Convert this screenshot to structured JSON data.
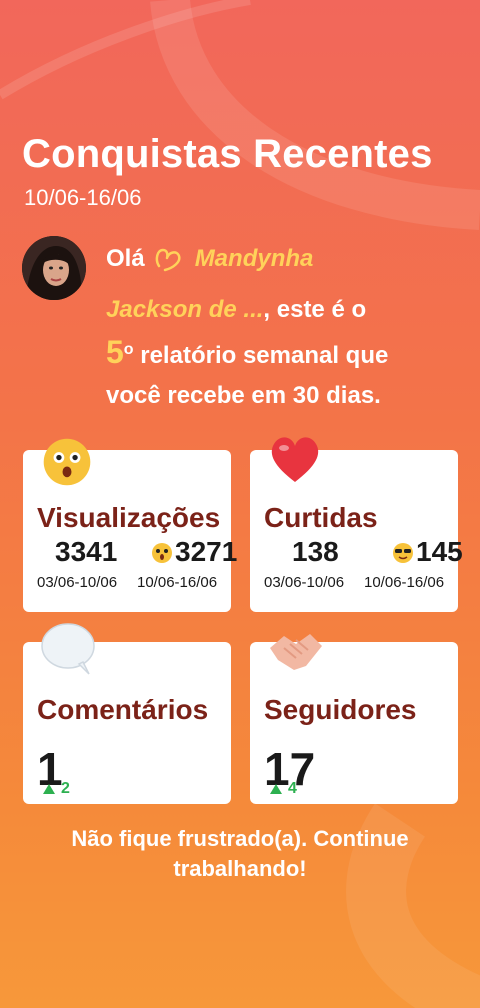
{
  "header": {
    "title": "Conquistas Recentes",
    "date_range": "10/06-16/06"
  },
  "greeting": {
    "hello": "Olá",
    "name": "Mandynha"
  },
  "message": {
    "name": "Jackson de ...",
    "part1": ", este é o",
    "number": "5",
    "ordinal": "o",
    "part2": " relatório semanal que",
    "part3": "você recebe em 30 dias."
  },
  "cards": {
    "views": {
      "title": "Visualizações",
      "prev_value": "3341",
      "curr_value": "3271",
      "prev_range": "03/06-10/06",
      "curr_range": "10/06-16/06",
      "emoji": "surprised-face-emoji"
    },
    "likes": {
      "title": "Curtidas",
      "prev_value": "138",
      "curr_value": "145",
      "prev_range": "03/06-10/06",
      "curr_range": "10/06-16/06",
      "emoji": "heart-emoji"
    },
    "comments": {
      "title": "Comentários",
      "value": "1",
      "delta": "2",
      "emoji": "speech-bubble-emoji"
    },
    "followers": {
      "title": "Seguidores",
      "value": "17",
      "delta": "4",
      "emoji": "handshake-emoji"
    }
  },
  "footer": {
    "text": "Não fique frustrado(a). Continue trabalhando!"
  },
  "colors": {
    "accent": "#ffd25a",
    "title_red": "#7b2218",
    "delta_green": "#2db050"
  }
}
